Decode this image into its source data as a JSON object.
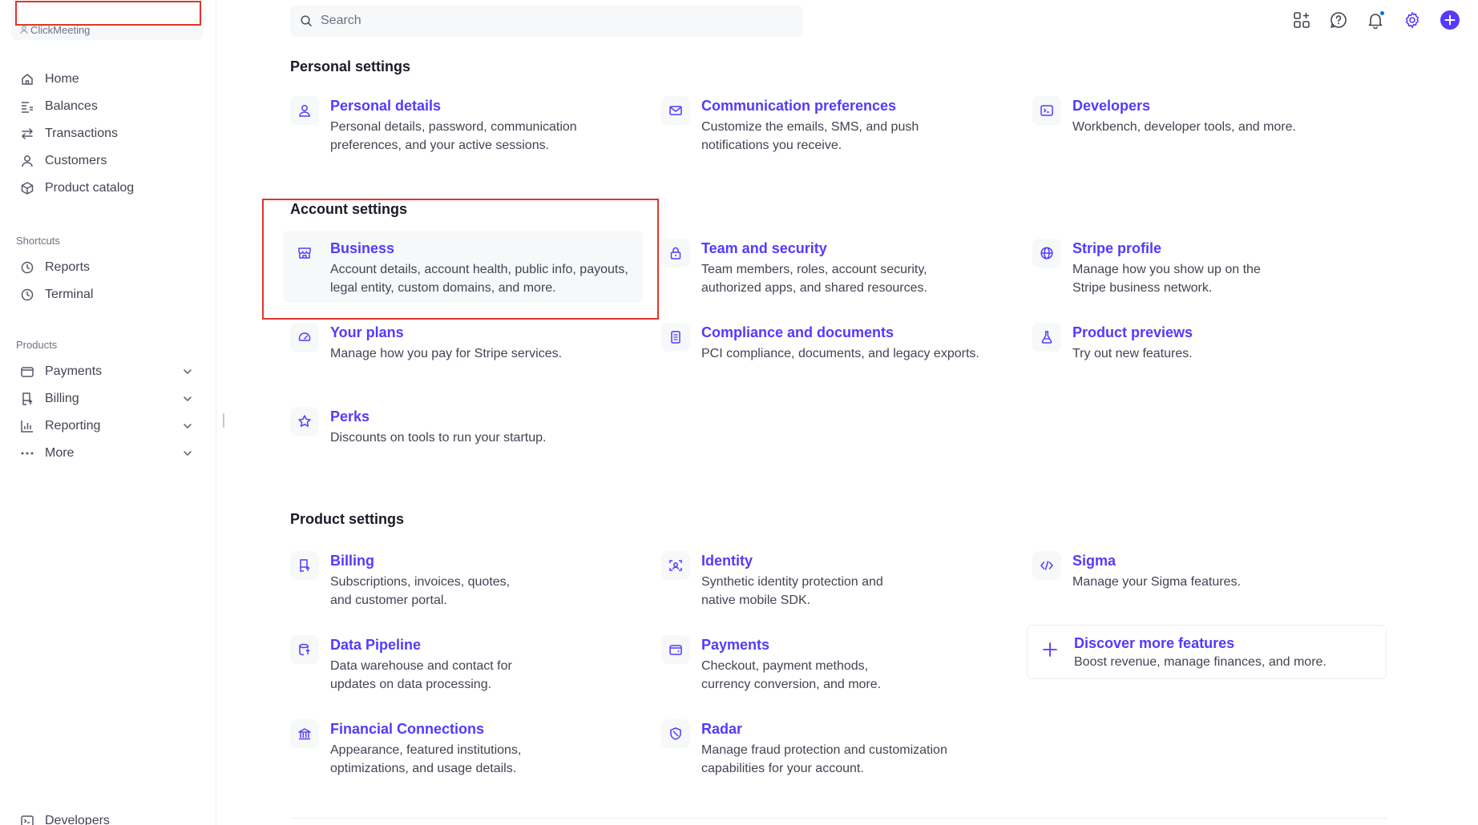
{
  "account": {
    "name": "ClickMeeting"
  },
  "search": {
    "placeholder": "Search"
  },
  "sidebar": {
    "main": [
      "Home",
      "Balances",
      "Transactions",
      "Customers",
      "Product catalog"
    ],
    "shortcuts_label": "Shortcuts",
    "shortcuts": [
      "Reports",
      "Terminal"
    ],
    "products_label": "Products",
    "products": [
      "Payments",
      "Billing",
      "Reporting",
      "More"
    ],
    "footer": "Developers"
  },
  "sections": {
    "personal": "Personal settings",
    "account": "Account settings",
    "product": "Product settings"
  },
  "cards": {
    "personal_details": {
      "title": "Personal details",
      "desc": "Personal details, password, communication preferences, and your active sessions."
    },
    "communication": {
      "title": "Communication preferences",
      "desc": "Customize the emails, SMS, and push notifications you receive."
    },
    "developers": {
      "title": "Developers",
      "desc": "Workbench, developer tools, and more."
    },
    "business": {
      "title": "Business",
      "desc": "Account details, account health, public info, payouts, legal entity, custom domains, and more."
    },
    "team_security": {
      "title": "Team and security",
      "desc": "Team members, roles, account security, authorized apps, and shared resources."
    },
    "stripe_profile": {
      "title": "Stripe profile",
      "desc": "Manage how you show up on the Stripe business network."
    },
    "your_plans": {
      "title": "Your plans",
      "desc": "Manage how you pay for Stripe services."
    },
    "compliance": {
      "title": "Compliance and documents",
      "desc": "PCI compliance, documents, and legacy exports."
    },
    "product_previews": {
      "title": "Product previews",
      "desc": "Try out new features."
    },
    "perks": {
      "title": "Perks",
      "desc": "Discounts on tools to run your startup."
    },
    "billing": {
      "title": "Billing",
      "desc": "Subscriptions, invoices, quotes, and customer portal."
    },
    "identity": {
      "title": "Identity",
      "desc": "Synthetic identity protection and native mobile SDK."
    },
    "sigma": {
      "title": "Sigma",
      "desc": "Manage your Sigma features."
    },
    "data_pipeline": {
      "title": "Data Pipeline",
      "desc": "Data warehouse and contact for updates on data processing."
    },
    "payments": {
      "title": "Payments",
      "desc": "Checkout, payment methods, currency conversion, and more."
    },
    "discover": {
      "title": "Discover more features",
      "desc": "Boost revenue, manage finances, and more."
    },
    "financial_connections": {
      "title": "Financial Connections",
      "desc": "Appearance, featured institutions, optimizations, and usage details."
    },
    "radar": {
      "title": "Radar",
      "desc": "Manage fraud protection and customization capabilities for your account."
    }
  },
  "colors": {
    "accent": "#533afd",
    "highlight_border": "#e0352b",
    "notification": "#0570de"
  }
}
